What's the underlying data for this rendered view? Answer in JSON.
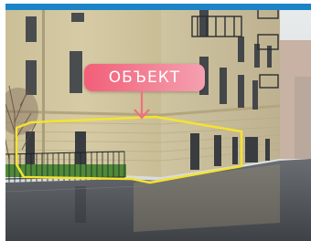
{
  "photo": {
    "description_label": "ОБЪЕКТ",
    "colors": {
      "top_bar": "#1a84c6",
      "pill_left": "#f25f78",
      "pill_right": "#f4a0b0",
      "highlight_outline": "#f5e330",
      "arrow": "#f07080"
    }
  }
}
